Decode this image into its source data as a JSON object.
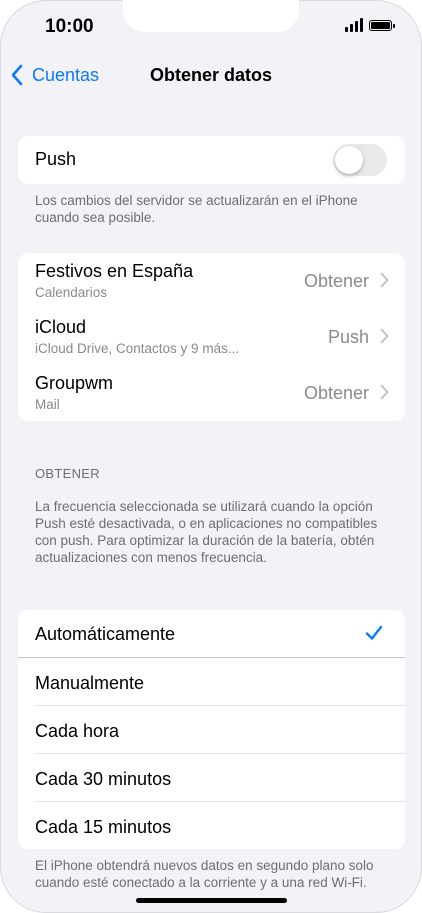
{
  "status": {
    "time": "10:00"
  },
  "nav": {
    "back_label": "Cuentas",
    "title": "Obtener datos"
  },
  "push": {
    "label": "Push",
    "enabled": false,
    "footnote": "Los cambios del servidor se actualizarán en el iPhone cuando sea posible."
  },
  "accounts": [
    {
      "name": "Festivos en España",
      "type": "Calendarios",
      "value": "Obtener"
    },
    {
      "name": "iCloud",
      "type": "iCloud Drive, Contactos y 9 más...",
      "value": "Push"
    },
    {
      "name": "Groupwm",
      "type": "Mail",
      "value": "Obtener"
    }
  ],
  "fetch": {
    "header": "OBTENER",
    "description": "La frecuencia seleccionada se utilizará cuando la opción Push esté desactivada, o en aplicaciones no compatibles con push. Para optimizar la duración de la batería, obtén actualizaciones con menos frecuencia.",
    "options": [
      {
        "label": "Automáticamente",
        "selected": true
      },
      {
        "label": "Manualmente",
        "selected": false
      },
      {
        "label": "Cada hora",
        "selected": false
      },
      {
        "label": "Cada 30 minutos",
        "selected": false
      },
      {
        "label": "Cada 15 minutos",
        "selected": false
      }
    ],
    "footnote": "El iPhone obtendrá nuevos datos en segundo plano solo cuando esté conectado a la corriente y a una red Wi-Fi."
  },
  "colors": {
    "accent": "#0a7aff",
    "background": "#f2f2f7",
    "secondary_text": "#8a8a8e"
  }
}
